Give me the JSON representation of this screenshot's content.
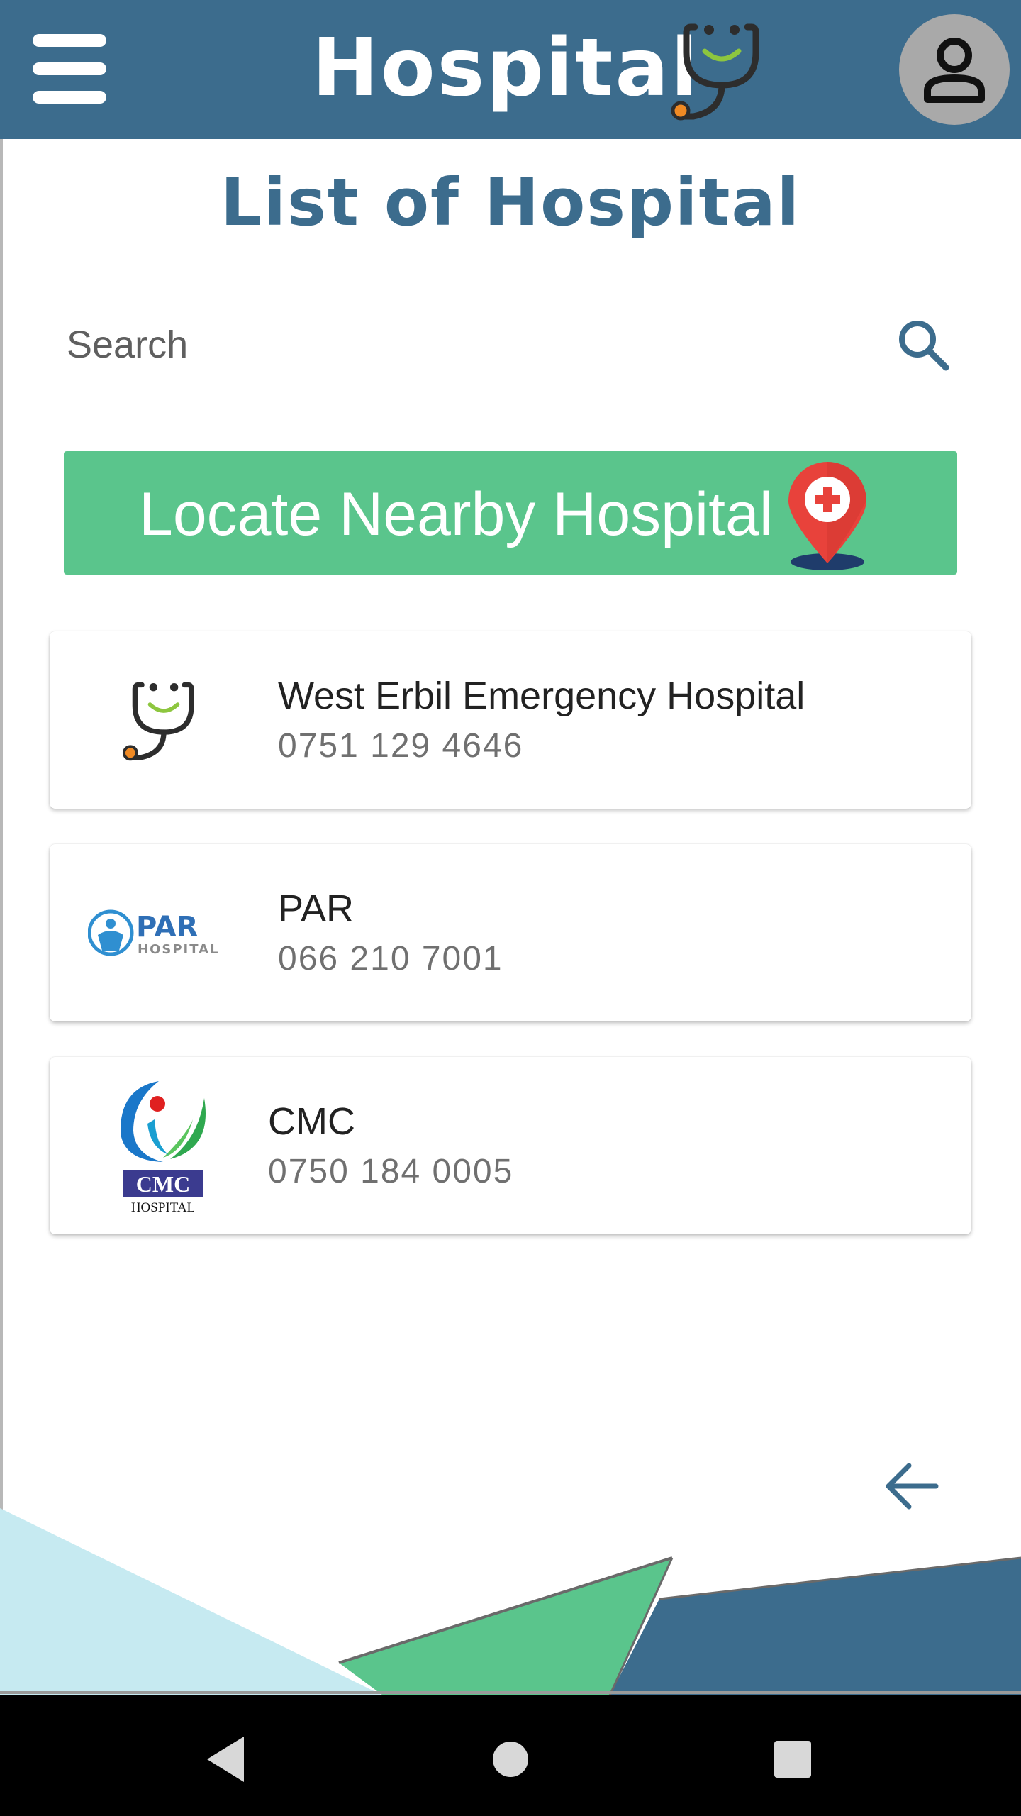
{
  "header": {
    "title": "Hospital",
    "menu_icon": "hamburger-menu-icon",
    "logo_icon": "stethoscope-smile-icon",
    "profile_icon": "user-profile-icon",
    "bar_color": "#3c6c8d"
  },
  "page": {
    "heading": "List of Hospital"
  },
  "search": {
    "placeholder": "Search",
    "value": "",
    "icon": "search-icon"
  },
  "locate": {
    "label": "Locate Nearby Hospital",
    "icon": "map-pin-hospital-icon",
    "color": "#5ac58c"
  },
  "hospitals": [
    {
      "name": "West Erbil Emergency Hospital",
      "phone": "0751 129 4646",
      "logo": "stethoscope-smile-logo"
    },
    {
      "name": "PAR",
      "phone": " 066 210 7001",
      "logo": "par-hospital-logo",
      "logo_text": "PAR",
      "logo_subtext": "HOSPITAL"
    },
    {
      "name": "CMC",
      "phone": "0750 184 0005",
      "logo": "cmc-hospital-logo",
      "logo_text": "CMC",
      "logo_subtext": "HOSPITAL"
    }
  ],
  "footer": {
    "back_icon": "arrow-left-icon"
  },
  "navbar": {
    "back_icon": "nav-back-triangle-icon",
    "home_icon": "nav-home-circle-icon",
    "recents_icon": "nav-recents-square-icon"
  }
}
